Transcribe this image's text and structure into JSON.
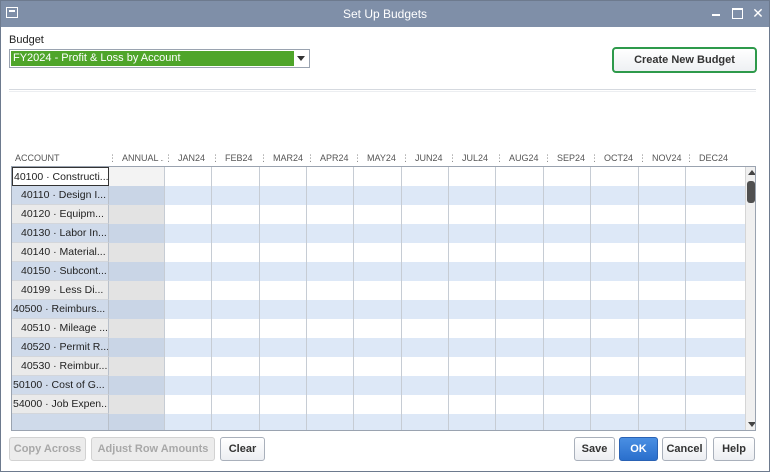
{
  "window": {
    "title": "Set Up Budgets"
  },
  "budget": {
    "label": "Budget",
    "selected": "FY2024 - Profit & Loss by Account",
    "create_label": "Create New Budget"
  },
  "grid": {
    "columns": [
      "ACCOUNT",
      "ANNUAL ...",
      "JAN24",
      "FEB24",
      "MAR24",
      "APR24",
      "MAY24",
      "JUN24",
      "JUL24",
      "AUG24",
      "SEP24",
      "OCT24",
      "NOV24",
      "DEC24"
    ],
    "rows": [
      "40100 · Constructi...",
      "40110 · Design I...",
      "40120 · Equipm...",
      "40130 · Labor In...",
      "40140 · Material...",
      "40150 · Subcont...",
      "40199 · Less Di...",
      "40500 · Reimburs...",
      "40510 · Mileage ...",
      "40520 · Permit R...",
      "40530 · Reimbur...",
      "50100 · Cost of G...",
      "54000 · Job Expen..."
    ]
  },
  "buttons": {
    "copy_across": "Copy Across",
    "adjust_rows": "Adjust Row Amounts",
    "clear": "Clear",
    "save": "Save",
    "ok": "OK",
    "cancel": "Cancel",
    "help": "Help"
  },
  "colors": {
    "title_bar": "#7f8fa8",
    "selection": "#4fa52a",
    "accent_border": "#2e9a4b",
    "ok_blue": "#2a6fcc",
    "alt_row": "#dde8f7"
  }
}
